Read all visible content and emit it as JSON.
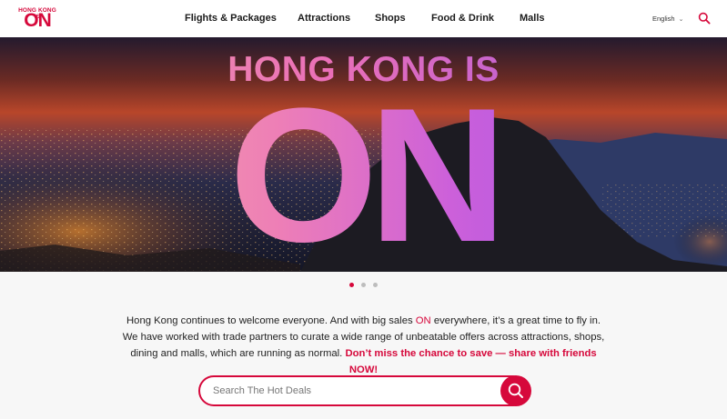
{
  "brand": {
    "logo_top": "HONG KONG IS",
    "logo_bottom": "ON",
    "accent_color": "#d6083b"
  },
  "nav": {
    "items": [
      {
        "label": "Flights & Packages"
      },
      {
        "label": "Attractions"
      },
      {
        "label": "Shops"
      },
      {
        "label": "Food & Drink"
      },
      {
        "label": "Malls"
      }
    ]
  },
  "language": {
    "selected": "English",
    "icon": "chevron-down-icon"
  },
  "header_search": {
    "icon": "search-icon"
  },
  "hero": {
    "line1": "HONG KONG IS",
    "line2": "ON",
    "slide_count": 3,
    "active_slide": 1
  },
  "intro": {
    "part1": "Hong Kong continues to welcome everyone. And with big sales ",
    "highlight1": "ON",
    "part2": " everywhere, it’s a great time to fly in. We have worked with trade partners to curate a wide range of unbeatable offers across attractions, shops, dining and malls, which are running as normal. ",
    "highlight2": "Don’t miss the chance to save — share with friends NOW!"
  },
  "deal_search": {
    "placeholder": "Search The Hot Deals",
    "value": "",
    "icon": "search-icon"
  }
}
